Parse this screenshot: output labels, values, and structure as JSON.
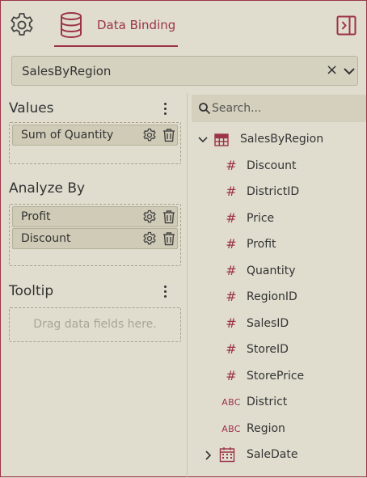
{
  "header": {
    "tab_label": "Data Binding"
  },
  "dataset": {
    "value": "SalesByRegion",
    "clear_glyph": "×"
  },
  "sections": {
    "values": {
      "title": "Values",
      "items": [
        "Sum of Quantity"
      ]
    },
    "analyze_by": {
      "title": "Analyze By",
      "items": [
        "Profit",
        "Discount"
      ]
    },
    "tooltip": {
      "title": "Tooltip",
      "placeholder": "Drag data fields here."
    }
  },
  "search": {
    "placeholder": "Search..."
  },
  "tree": {
    "root": {
      "label": "SalesByRegion",
      "icon": "table-icon"
    },
    "fields": [
      {
        "label": "Discount",
        "type": "numeric",
        "glyph": "#"
      },
      {
        "label": "DistrictID",
        "type": "numeric",
        "glyph": "#"
      },
      {
        "label": "Price",
        "type": "numeric",
        "glyph": "#"
      },
      {
        "label": "Profit",
        "type": "numeric",
        "glyph": "#"
      },
      {
        "label": "Quantity",
        "type": "numeric",
        "glyph": "#"
      },
      {
        "label": "RegionID",
        "type": "numeric",
        "glyph": "#"
      },
      {
        "label": "SalesID",
        "type": "numeric",
        "glyph": "#"
      },
      {
        "label": "StoreID",
        "type": "numeric",
        "glyph": "#"
      },
      {
        "label": "StorePrice",
        "type": "numeric",
        "glyph": "#"
      },
      {
        "label": "District",
        "type": "text",
        "glyph": "ABC"
      },
      {
        "label": "Region",
        "type": "text",
        "glyph": "ABC"
      },
      {
        "label": "SaleDate",
        "type": "date",
        "glyph": "calendar-icon"
      }
    ]
  },
  "colors": {
    "accent": "#9c3346",
    "background": "#e0ddcf",
    "chip": "#cfcbb6"
  }
}
